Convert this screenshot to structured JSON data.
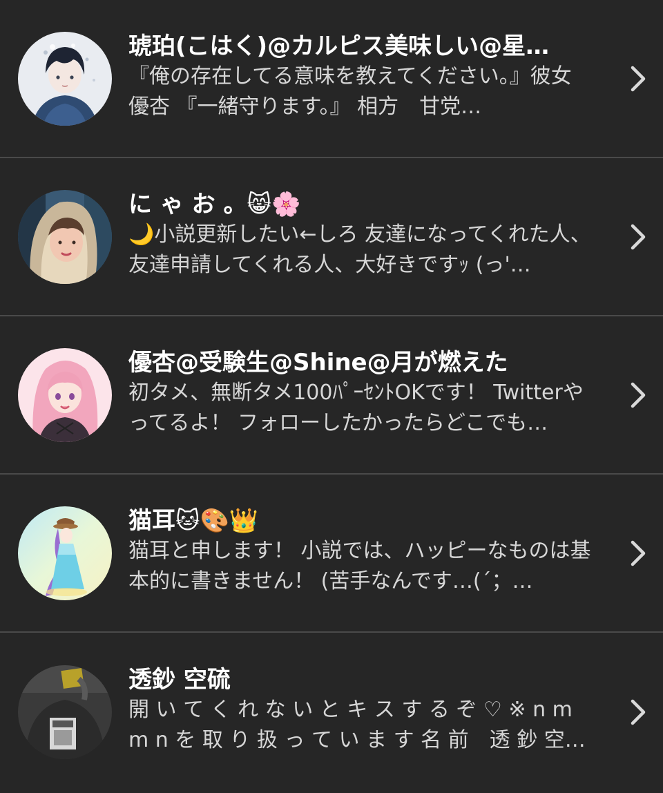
{
  "users": [
    {
      "name": "琥珀(こはく)@カルピス美味しい@星…",
      "bio": "『俺の存在してる意味を教えてください。』彼女　優杏 『一緒守ります。』 相方　甘党…",
      "avatar_icon": "anime-boy-avatar-icon"
    },
    {
      "name": "に ゃ お 。😸🌸",
      "bio": "🌙小説更新したい←しろ 友達になってくれた人、友達申請してくれる人、大好きですｯ (っ'…",
      "avatar_icon": "hooded-person-avatar-icon"
    },
    {
      "name": "優杏@受験生@Shine@月が燃えた",
      "bio": "初タメ、無断タメ100ﾊﾟｰｾﾝﾄOKです！ Twitterやってるよ！ フォローしたかったらどこでも…",
      "avatar_icon": "pink-hair-girl-avatar-icon"
    },
    {
      "name": "猫耳🐱🎨👑",
      "bio": "猫耳と申します！ 小説では、ハッピーなものは基本的に書きません！ (苦手なんです…(´；…",
      "avatar_icon": "purple-hair-girl-avatar-icon"
    },
    {
      "name": "透鈔 空硫",
      "bio": "開 い て く れ な い と キ ス す る ぞ ♡ ※ n m m n を 取 り 扱 っ て い ま す 名 前　透 鈔 空…",
      "avatar_icon": "person-photo-avatar-icon"
    }
  ],
  "colors": {
    "background": "#262626",
    "divider": "#4a4a4a",
    "name_text": "#ffffff",
    "bio_text": "#d6d6d6",
    "chevron": "#d9d9d9"
  },
  "chevron_icon": "chevron-right-icon"
}
